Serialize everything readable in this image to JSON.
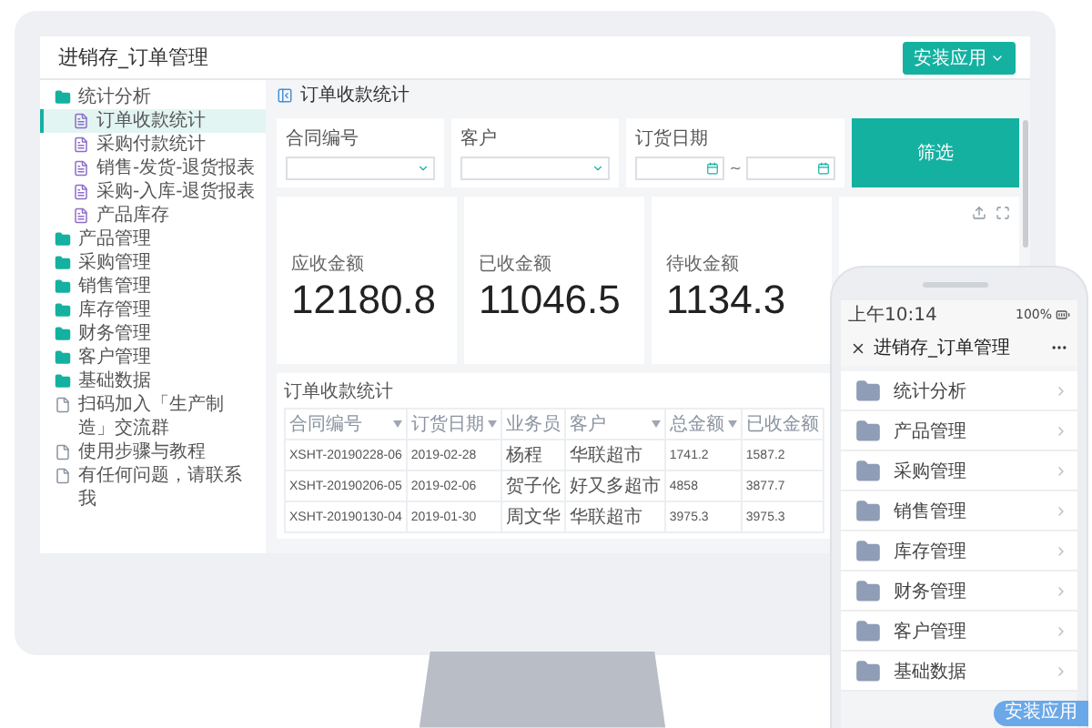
{
  "app": {
    "title": "进销存_订单管理",
    "install_button": "安装应用"
  },
  "sidebar": {
    "items": [
      {
        "label": "统计分析",
        "kind": "folder",
        "selected": false,
        "children": [
          {
            "label": "订单收款统计",
            "kind": "report",
            "selected": true
          },
          {
            "label": "采购付款统计",
            "kind": "report",
            "selected": false
          },
          {
            "label": "销售-发货-退货报表",
            "kind": "report",
            "selected": false
          },
          {
            "label": "采购-入库-退货报表",
            "kind": "report",
            "selected": false
          },
          {
            "label": "产品库存",
            "kind": "report",
            "selected": false
          }
        ]
      },
      {
        "label": "产品管理",
        "kind": "folder",
        "selected": false
      },
      {
        "label": "采购管理",
        "kind": "folder",
        "selected": false
      },
      {
        "label": "销售管理",
        "kind": "folder",
        "selected": false
      },
      {
        "label": "库存管理",
        "kind": "folder",
        "selected": false
      },
      {
        "label": "财务管理",
        "kind": "folder",
        "selected": false
      },
      {
        "label": "客户管理",
        "kind": "folder",
        "selected": false
      },
      {
        "label": "基础数据",
        "kind": "folder",
        "selected": false
      },
      {
        "label": "扫码加入「生产制造」交流群",
        "kind": "doc",
        "selected": false
      },
      {
        "label": "使用步骤与教程",
        "kind": "doc",
        "selected": false
      },
      {
        "label": "有任何问题，请联系我",
        "kind": "doc",
        "selected": false
      }
    ]
  },
  "breadcrumb": "订单收款统计",
  "filters": [
    {
      "label": "合同编号",
      "kind": "select"
    },
    {
      "label": "客户",
      "kind": "select"
    },
    {
      "label": "订货日期",
      "kind": "date_range",
      "separator": "~"
    }
  ],
  "filter_button": "筛选",
  "stats": [
    {
      "label": "应收金额",
      "value": "12180.8"
    },
    {
      "label": "已收金额",
      "value": "11046.5"
    },
    {
      "label": "待收金额",
      "value": "1134.3"
    }
  ],
  "table": {
    "title": "订单收款统计",
    "columns": [
      {
        "label": "合同编号",
        "sortable": true
      },
      {
        "label": "订货日期",
        "sortable": true
      },
      {
        "label": "业务员",
        "sortable": false
      },
      {
        "label": "客户",
        "sortable": true
      },
      {
        "label": "总金额",
        "sortable": true
      },
      {
        "label": "已收金额",
        "sortable": false
      }
    ],
    "rows": [
      [
        "XSHT-20190228-06",
        "2019-02-28",
        "杨程",
        "华联超市",
        "1741.2",
        "1587.2"
      ],
      [
        "XSHT-20190206-05",
        "2019-02-06",
        "贺子伦",
        "好又多超市",
        "4858",
        "3877.7"
      ],
      [
        "XSHT-20190130-04",
        "2019-01-30",
        "周文华",
        "华联超市",
        "3975.3",
        "3975.3"
      ]
    ]
  },
  "phone": {
    "time": "上午10:14",
    "battery": "100%",
    "title": "进销存_订单管理",
    "items": [
      "统计分析",
      "产品管理",
      "采购管理",
      "销售管理",
      "库存管理",
      "财务管理",
      "客户管理",
      "基础数据"
    ],
    "install_button": "安装应用"
  }
}
